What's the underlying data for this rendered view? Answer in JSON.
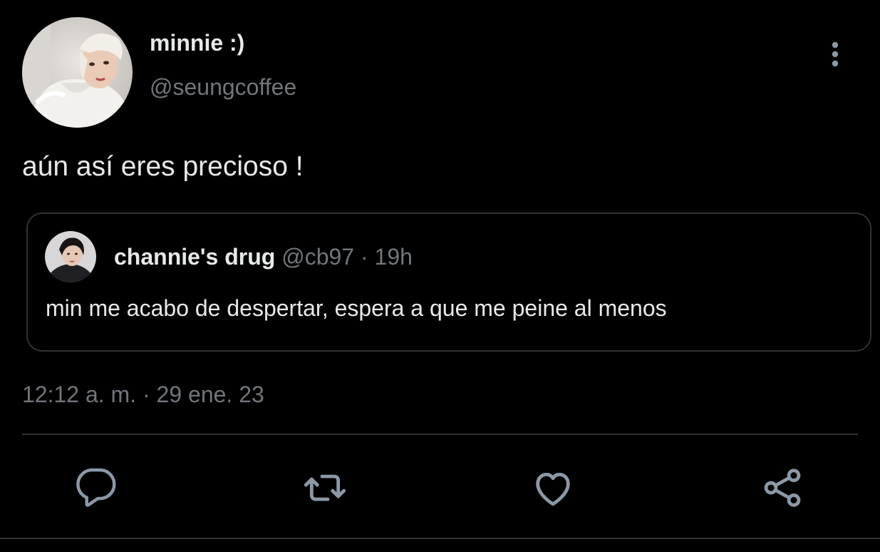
{
  "author": {
    "display_name": "minnie :)",
    "handle": "@seungcoffee",
    "avatar_icon": "profile-photo"
  },
  "tweet": {
    "text": "aún así eres precioso !",
    "time": "12:12 a. m.",
    "separator": "·",
    "date": "29 ene. 23"
  },
  "quote": {
    "display_name": "channie's drug",
    "handle": "@cb97",
    "separator": "·",
    "time": "19h",
    "text": "min me acabo de despertar, espera a que me peine al menos",
    "avatar_icon": "profile-photo"
  },
  "actions": [
    {
      "icon": "reply-icon"
    },
    {
      "icon": "retweet-icon"
    },
    {
      "icon": "like-icon"
    },
    {
      "icon": "share-icon"
    }
  ],
  "menu_icon": "more-vertical-icon",
  "colors": {
    "background": "#000000",
    "primary_text": "#e7e9ea",
    "secondary_text": "#71767b",
    "border": "#2f3336",
    "icon": "#8b98a5"
  }
}
